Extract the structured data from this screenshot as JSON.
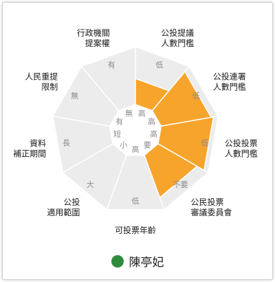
{
  "chart_data": {
    "type": "radar",
    "axes": [
      {
        "name": [
          "公投提議",
          "人數門檻"
        ],
        "ticks": [
          "低",
          "",
          "高"
        ]
      },
      {
        "name": [
          "公投連署",
          "人數門檻"
        ],
        "ticks": [
          "低",
          "",
          "高"
        ]
      },
      {
        "name": [
          "公投投票",
          "人數門檻"
        ],
        "ticks": [
          "低",
          "",
          "高"
        ]
      },
      {
        "name": [
          "公民投票",
          "審議委員會"
        ],
        "ticks": [
          "不要",
          "",
          "要"
        ]
      },
      {
        "name": [
          "可投票年齡"
        ],
        "ticks": [
          "低",
          "",
          "高"
        ]
      },
      {
        "name": [
          "公投",
          "適用範圍"
        ],
        "ticks": [
          "大",
          "",
          "小"
        ]
      },
      {
        "name": [
          "資料",
          "補正期間"
        ],
        "ticks": [
          "長",
          "",
          "短"
        ]
      },
      {
        "name": [
          "人民重提",
          "限制"
        ],
        "ticks": [
          "無",
          "",
          "有"
        ]
      },
      {
        "name": [
          "行政機關",
          "提案權"
        ],
        "ticks": [
          "有",
          "",
          "無"
        ]
      }
    ],
    "series": [
      {
        "name": "陳亭妃",
        "values": [
          0.45,
          0.88,
          0.92,
          0.78,
          0,
          0,
          0,
          0,
          0
        ]
      }
    ],
    "scale": [
      0,
      1
    ],
    "legend_position": "bottom"
  },
  "colors": {
    "fill": "#f7a42c",
    "grid": "#ececec",
    "grid_line": "#ffffff",
    "legend_dot": "#2e8b3e",
    "tick_text": "#8a8a8a",
    "label_text": "#1a1a1a"
  }
}
